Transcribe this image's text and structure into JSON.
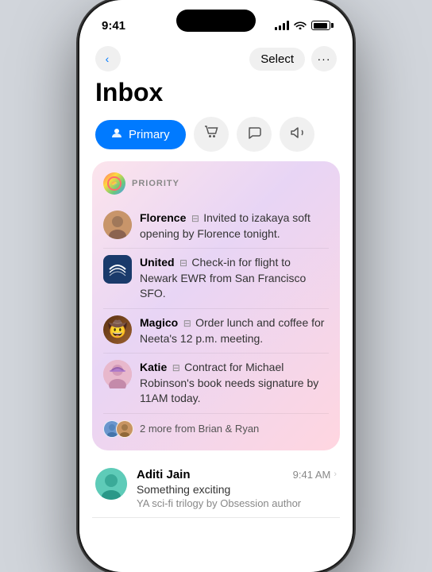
{
  "statusBar": {
    "time": "9:41",
    "batteryLevel": "90%"
  },
  "navigation": {
    "backButton": "‹",
    "selectButton": "Select",
    "moreButton": "···"
  },
  "pageTitle": "Inbox",
  "tabs": [
    {
      "id": "primary",
      "label": "Primary",
      "icon": "person",
      "active": true
    },
    {
      "id": "shopping",
      "label": "Shopping",
      "icon": "cart",
      "active": false
    },
    {
      "id": "chat",
      "label": "Chat",
      "icon": "bubble",
      "active": false
    },
    {
      "id": "updates",
      "label": "Updates",
      "icon": "megaphone",
      "active": false
    }
  ],
  "prioritySection": {
    "label": "PRIORITY",
    "items": [
      {
        "id": "florence",
        "sender": "Florence",
        "snippet": "Invited to izakaya soft opening by Florence tonight.",
        "hasAction": true
      },
      {
        "id": "united",
        "sender": "United",
        "snippet": "Check-in for flight to Newark EWR from San Francisco SFO.",
        "hasAction": true
      },
      {
        "id": "magico",
        "sender": "Magico",
        "snippet": "Order lunch and coffee for Neeta's 12 p.m. meeting.",
        "hasAction": true
      },
      {
        "id": "katie",
        "sender": "Katie",
        "snippet": "Contract for Michael Robinson's book needs signature by 11AM today.",
        "hasAction": true
      }
    ],
    "moreText": "2 more from Brian & Ryan"
  },
  "mailItems": [
    {
      "id": "aditi",
      "sender": "Aditi Jain",
      "time": "9:41 AM",
      "subject": "Something exciting",
      "snippet": "YA sci-fi trilogy by Obsession author"
    }
  ]
}
